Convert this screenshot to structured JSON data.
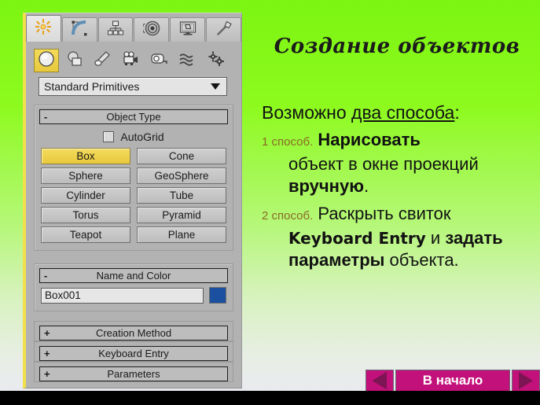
{
  "slide": {
    "title": "Создание объектов",
    "background_top_color": "#7cf512",
    "background_bottom_color": "#e9eaf0"
  },
  "command_panel": {
    "tabs": [
      {
        "name": "create-tab",
        "icon": "star-icon",
        "active": true
      },
      {
        "name": "modify-tab",
        "icon": "curve-icon",
        "active": false
      },
      {
        "name": "hierarchy-tab",
        "icon": "hierarchy-icon",
        "active": false
      },
      {
        "name": "motion-tab",
        "icon": "spiral-icon",
        "active": false
      },
      {
        "name": "display-tab",
        "icon": "monitor-icon",
        "active": false
      },
      {
        "name": "utilities-tab",
        "icon": "hammer-icon",
        "active": false
      }
    ],
    "categories": [
      {
        "name": "geometry-category",
        "icon": "sphere-icon",
        "active": true
      },
      {
        "name": "shapes-category",
        "icon": "shapes-icon",
        "active": false
      },
      {
        "name": "lights-category",
        "icon": "light-icon",
        "active": false
      },
      {
        "name": "cameras-category",
        "icon": "camera-icon",
        "active": false
      },
      {
        "name": "helpers-category",
        "icon": "tape-measure-icon",
        "active": false
      },
      {
        "name": "spacewarps-category",
        "icon": "waves-icon",
        "active": false
      },
      {
        "name": "systems-category",
        "icon": "gears-icon",
        "active": false
      }
    ],
    "dropdown": {
      "value": "Standard Primitives",
      "icon": "chevron-down-icon"
    },
    "object_type": {
      "header": "Object Type",
      "expander": "-",
      "autogrid_label": "AutoGrid",
      "autogrid_checked": false,
      "buttons": [
        {
          "label": "Box",
          "selected": true
        },
        {
          "label": "Cone",
          "selected": false
        },
        {
          "label": "Sphere",
          "selected": false
        },
        {
          "label": "GeoSphere",
          "selected": false
        },
        {
          "label": "Cylinder",
          "selected": false
        },
        {
          "label": "Tube",
          "selected": false
        },
        {
          "label": "Torus",
          "selected": false
        },
        {
          "label": "Pyramid",
          "selected": false
        },
        {
          "label": "Teapot",
          "selected": false
        },
        {
          "label": "Plane",
          "selected": false
        }
      ]
    },
    "name_and_color": {
      "header": "Name and Color",
      "expander": "-",
      "name_value": "Box001",
      "color_value": "#1b4fa0"
    },
    "collapsed_rollouts": [
      {
        "expander": "+",
        "header": "Creation Method"
      },
      {
        "expander": "+",
        "header": "Keyboard Entry"
      },
      {
        "expander": "+",
        "header": "Parameters"
      }
    ]
  },
  "content": {
    "intro_prefix": "Возможно ",
    "intro_underlined": "два способа",
    "intro_suffix": ":",
    "method1": {
      "marker": "1 способ.",
      "bold1": "Нарисовать",
      "normal1": "объект в окне проекций ",
      "bold2": "вручную",
      "tail": "."
    },
    "method2": {
      "marker": "2 способ.",
      "normal1": "Раскрыть свиток",
      "mono": "Keyboard Entry",
      "conj": " и ",
      "bold1": "задать параметры",
      "normal2": " объекта."
    }
  },
  "nav": {
    "prev_icon": "triangle-left-icon",
    "home_label": "В начало",
    "next_icon": "triangle-right-icon",
    "bar_color": "#c2117a"
  }
}
